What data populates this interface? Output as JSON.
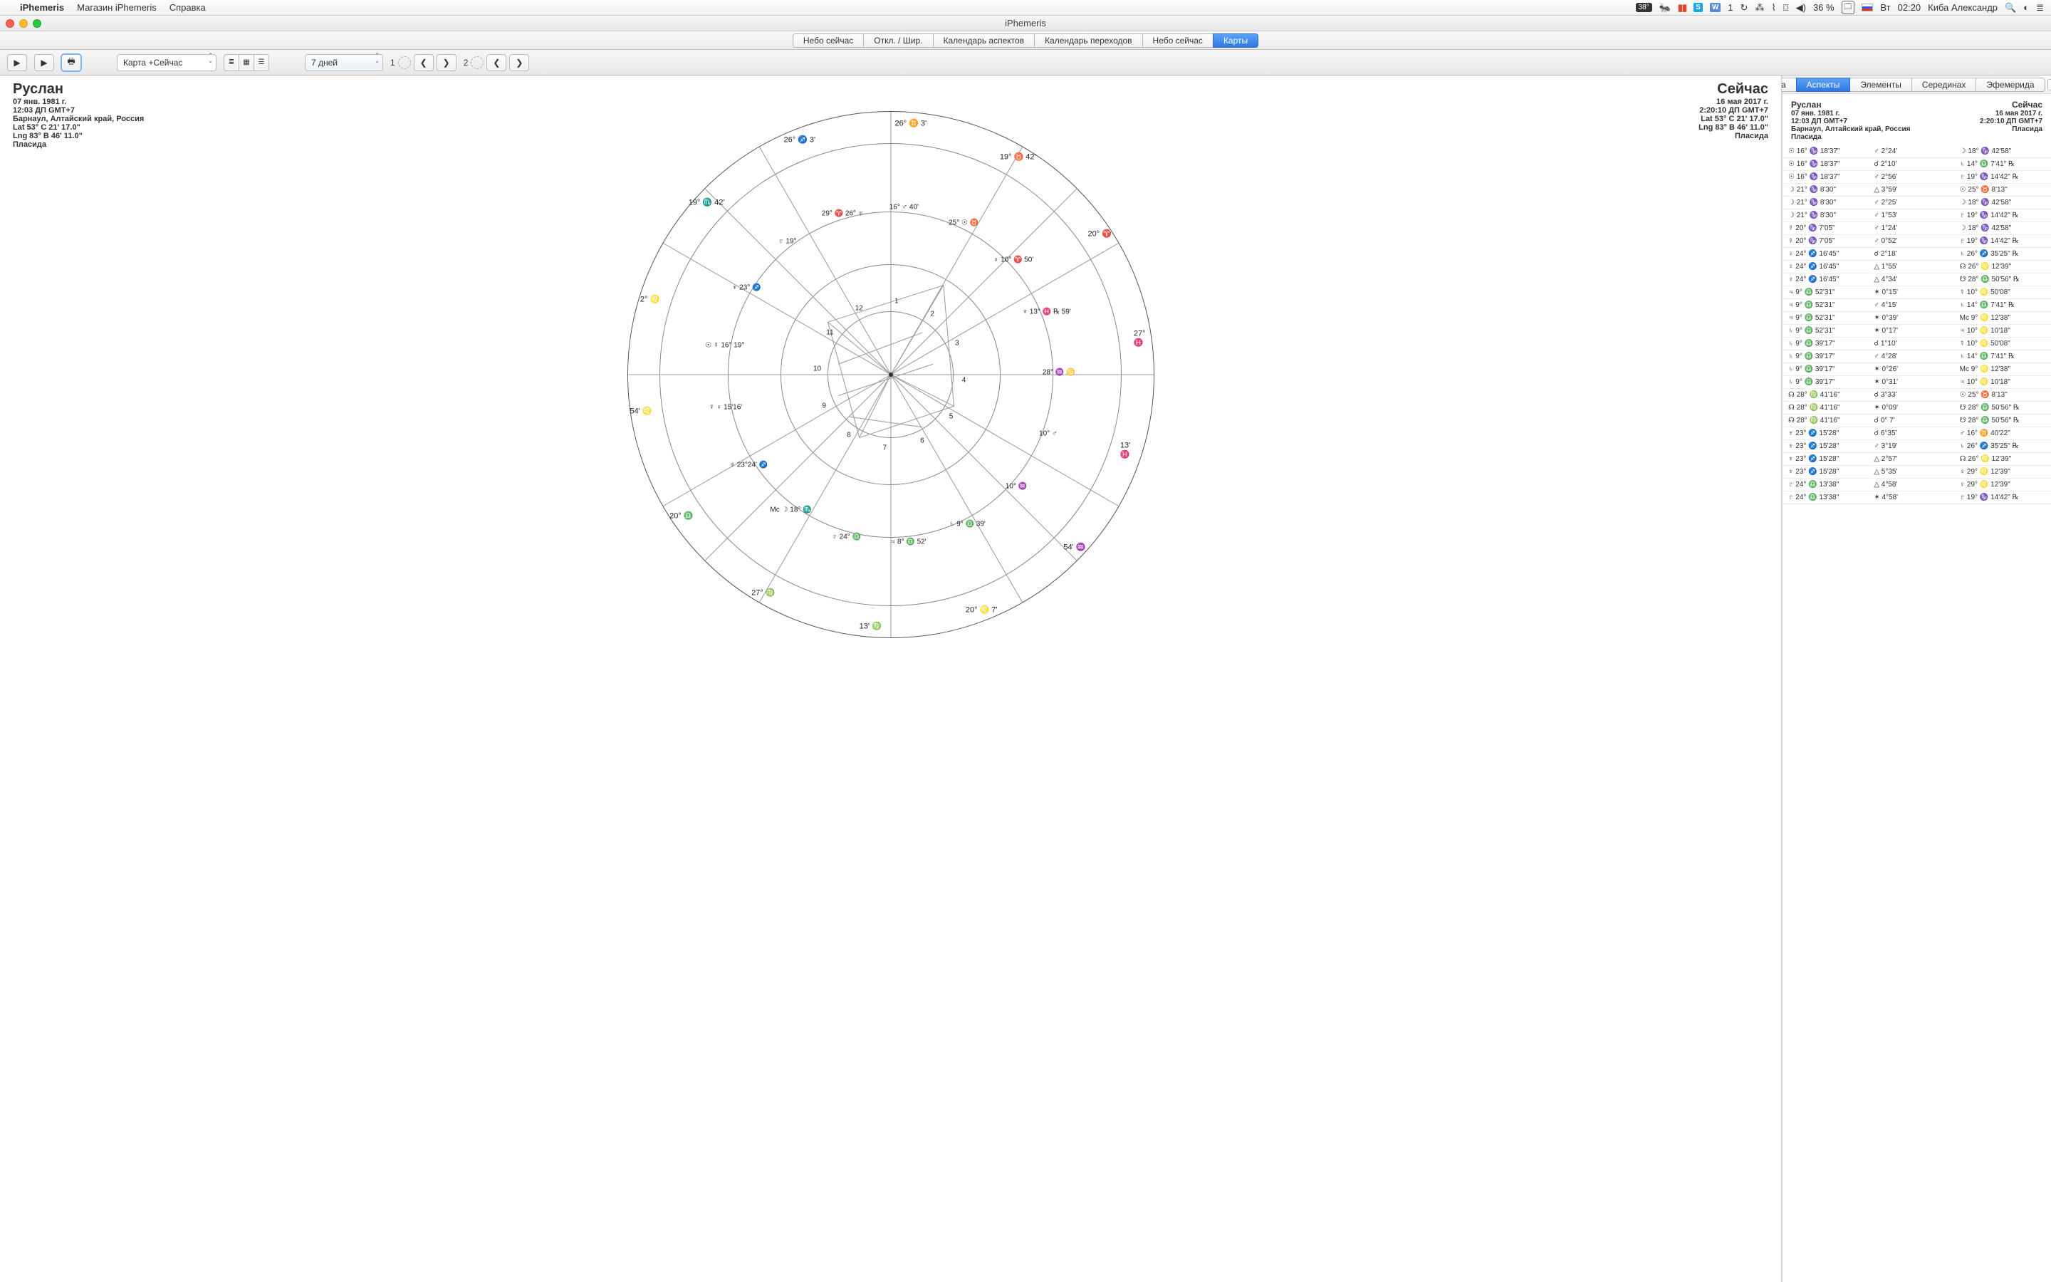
{
  "menubar": {
    "apple": "",
    "app": "iPhemeris",
    "items": [
      "Магазин iPhemeris",
      "Справка"
    ],
    "status": {
      "temp": "38°",
      "temp_icon": "🐜",
      "pause": "▮▮",
      "skype": "S",
      "vk": "W",
      "vk_count": "1",
      "clock_glyph": "↻",
      "bt": "⁂",
      "wifi": "⌇",
      "display": "⌼",
      "vol": "◀)",
      "battery_pct": "36 %",
      "battery_glyph": "🗔",
      "day": "Вт",
      "time": "02:20",
      "user": "Киба Александр",
      "search": "🔍",
      "menu": "≣",
      "siri": "◐"
    }
  },
  "window": {
    "title": "iPhemeris"
  },
  "tabs": {
    "items": [
      "Небо сейчас",
      "Откл. / Шир.",
      "Календарь аспектов",
      "Календарь переходов",
      "Небо сейчас",
      "Карты"
    ],
    "active": 5
  },
  "toolbar": {
    "play1": "▶",
    "play2": "▶",
    "print": "🖶",
    "chart_select": "Карта +Сейчас",
    "view1": "≣",
    "view2": "▦",
    "view3": "☰",
    "range": "7 дней",
    "nav1_num": "1",
    "nav2_num": "2",
    "prev": "❮",
    "next": "❯"
  },
  "chart": {
    "left": {
      "name": "Руслан",
      "date": "07 янв. 1981 г.",
      "time": "12:03 ДП GMT+7",
      "place": "Барнаул, Алтайский край, Россия",
      "lat": "Lat 53° C 21' 17.0\"",
      "lng": "Lng 83° B 46' 11.0\"",
      "house": "Пласида"
    },
    "right": {
      "name": "Сейчас",
      "date": "16 мая 2017 г.",
      "time": "2:20:10 ДП GMT+7",
      "lat": "Lat 53° C 21' 17.0\"",
      "lng": "Lng 83° B 46' 11.0\"",
      "house": "Пласида"
    },
    "outer_marks": [
      "26° ♊ 3'",
      "19° ♉ 42'",
      "20° ♈",
      "27° ♓",
      "13' ♓",
      "54' ♒",
      "20° ♌ 7'",
      "13' ♍",
      "27° ♍",
      "20° ♎",
      "54' ♌",
      "2° ♌",
      "19° ♏ 42'",
      "26° ♐ 3'"
    ],
    "inner_houses": [
      "1",
      "2",
      "3",
      "4",
      "5",
      "6",
      "7",
      "8",
      "9",
      "10",
      "11",
      "12"
    ],
    "inner_marks": [
      "16° ♂ 40'",
      "25° ☉ ♉",
      "♀ 10° ♈ 50'",
      "♆ 13° ♓ ℞ 59'",
      "28° ♒ ♋",
      "10° ♂",
      "10° ♒",
      "♄ 9° ♎ 39'",
      "♃ 8° ♎ 52'",
      "♇ 24° ♎",
      "Mc ☽ 18° ♏",
      "♅ 23°24' ♐",
      "☿ ♀ 15'16'",
      "☉ ☿ 16° 19°",
      "♆ 23° ♐",
      "♇ 19°",
      "29° ♈ 26° ♅"
    ]
  },
  "aspects": {
    "tabs": [
      "Сетка",
      "Аспекты",
      "Элементы",
      "Серединах",
      "Эфемерида"
    ],
    "active": 1,
    "header_left_name": "Руслан",
    "header_left_date": "07 янв. 1981 г.",
    "header_left_time": "12:03 ДП GMT+7",
    "header_left_place": "Барнаул, Алтайский край, Россия",
    "header_left_house": "Пласида",
    "header_right_name": "Сейчас",
    "header_right_date": "16 мая 2017 г.",
    "header_right_time": "2:20:10 ДП GMT+7",
    "header_right_house": "Пласида",
    "rows": [
      [
        "☉ 16° ♑ 18'37\"",
        "♂ 2°24'",
        "☽ 18° ♑ 42'58\""
      ],
      [
        "☉ 16° ♑ 18'37\"",
        "☌ 2°10'",
        "♄ 14° ♎ 7'41\" ℞"
      ],
      [
        "☉ 16° ♑ 18'37\"",
        "♂ 2°56'",
        "♇ 19° ♑ 14'42\" ℞"
      ],
      [
        "☽ 21° ♑ 8'30\"",
        "△ 3°59'",
        "☉ 25° ♉ 8'13\""
      ],
      [
        "☽ 21° ♑ 8'30\"",
        "♂ 2°25'",
        "☽ 18° ♑ 42'58\""
      ],
      [
        "☽ 21° ♑ 8'30\"",
        "♂ 1°53'",
        "♇ 19° ♑ 14'42\" ℞"
      ],
      [
        "☿ 20° ♑ 7'05\"",
        "♂ 1°24'",
        "☽ 18° ♑ 42'58\""
      ],
      [
        "☿ 20° ♑ 7'05\"",
        "♂ 0°52'",
        "♇ 19° ♑ 14'42\" ℞"
      ],
      [
        "♀ 24° ♐ 16'45\"",
        "☌ 2°18'",
        "♄ 26° ♐ 35'25\" ℞"
      ],
      [
        "♀ 24° ♐ 16'45\"",
        "△ 1°55'",
        "☊ 26° ♌ 12'39\""
      ],
      [
        "♀ 24° ♐ 16'45\"",
        "△ 4°34'",
        "☋ 28° ♎ 50'56\" ℞"
      ],
      [
        "♃ 9° ♎ 52'31\"",
        "✶ 0°15'",
        "☿ 10° ♌ 50'08\""
      ],
      [
        "♃ 9° ♎ 52'31\"",
        "♂ 4°15'",
        "♄ 14° ♎ 7'41\" ℞"
      ],
      [
        "♃ 9° ♎ 52'31\"",
        "✶ 0°39'",
        "Mc 9° ♌ 12'38\""
      ],
      [
        "♄ 9° ♎ 52'31\"",
        "✶ 0°17'",
        "♃ 10° ♌ 10'18\""
      ],
      [
        "♄ 9° ♎ 39'17\"",
        "☌ 1°10'",
        "☿ 10° ♌ 50'08\""
      ],
      [
        "♄ 9° ♎ 39'17\"",
        "♂ 4°28'",
        "♄ 14° ♎ 7'41\" ℞"
      ],
      [
        "♄ 9° ♎ 39'17\"",
        "✶ 0°26'",
        "Mc 9° ♌ 12'38\""
      ],
      [
        "♄ 9° ♎ 39'17\"",
        "✶ 0°31'",
        "♃ 10° ♌ 10'18\""
      ],
      [
        "☊ 28° ♍ 41'16\"",
        "☌ 3°33'",
        "☉ 25° ♉ 8'13\""
      ],
      [
        "☊ 28° ♍ 41'16\"",
        "✶ 0°09'",
        "☋ 28° ♎ 50'56\" ℞"
      ],
      [
        "☊ 28° ♍ 41'16\"",
        "☌ 0° 7'",
        "☋ 28° ♎ 50'56\" ℞"
      ],
      [
        "♆ 23° ♐ 15'28\"",
        "☌ 6°35'",
        "♂ 16° ♊ 40'22\""
      ],
      [
        "♆ 23° ♐ 15'28\"",
        "♂ 3°19'",
        "♄ 26° ♐ 35'25\" ℞"
      ],
      [
        "♆ 23° ♐ 15'28\"",
        "△ 2°57'",
        "☊ 26° ♌ 12'39\""
      ],
      [
        "♆ 23° ♐ 15'28\"",
        "△ 5°35'",
        "♀ 29° ♌ 12'39\""
      ],
      [
        "♇ 24° ♎ 13'38\"",
        "△ 4°58'",
        "♀ 29° ♌ 12'39\""
      ],
      [
        "♇ 24° ♎ 13'38\"",
        "✶ 4°58'",
        "♇ 19° ♑ 14'42\" ℞"
      ]
    ]
  }
}
